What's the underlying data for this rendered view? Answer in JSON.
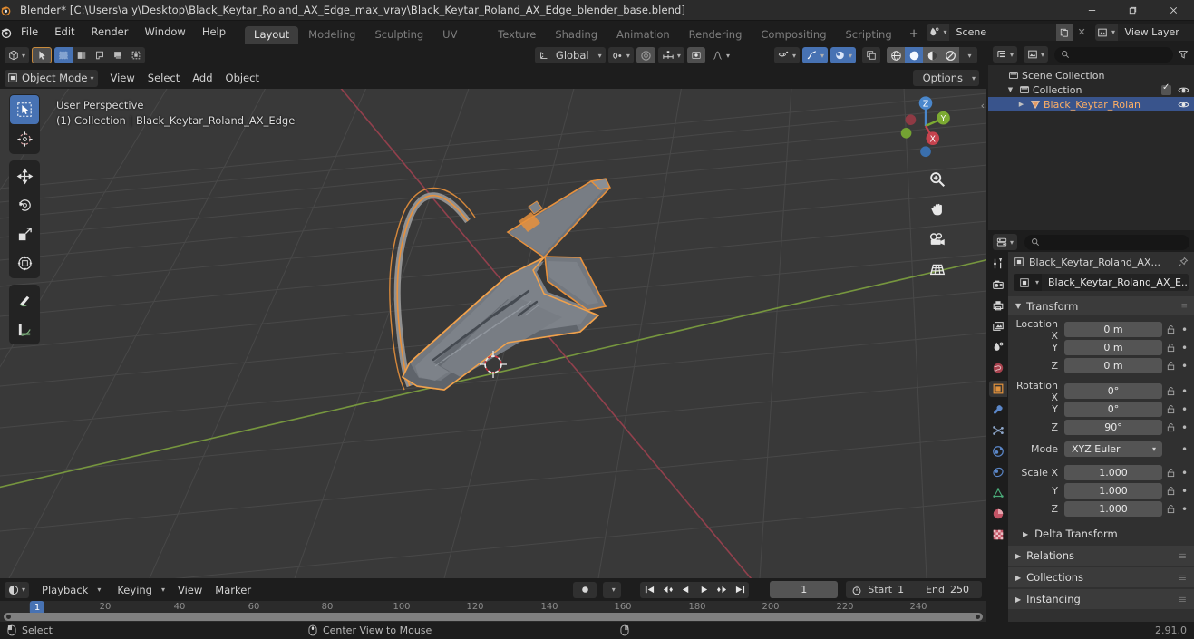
{
  "window": {
    "title": "Blender* [C:\\Users\\a y\\Desktop\\Black_Keytar_Roland_AX_Edge_max_vray\\Black_Keytar_Roland_AX_Edge_blender_base.blend]",
    "minimize": "—",
    "maximize": "❐",
    "close": "✕"
  },
  "topbar": {
    "menus": [
      "File",
      "Edit",
      "Render",
      "Window",
      "Help"
    ],
    "workspace_tabs": [
      {
        "label": "Layout",
        "active": true
      },
      {
        "label": "Modeling",
        "active": false
      },
      {
        "label": "Sculpting",
        "active": false
      },
      {
        "label": "UV Editing",
        "active": false
      },
      {
        "label": "Texture Paint",
        "active": false
      },
      {
        "label": "Shading",
        "active": false
      },
      {
        "label": "Animation",
        "active": false
      },
      {
        "label": "Rendering",
        "active": false
      },
      {
        "label": "Compositing",
        "active": false
      },
      {
        "label": "Scripting",
        "active": false
      }
    ],
    "add_workspace": "+",
    "scene_name": "Scene",
    "view_layer_name": "View Layer"
  },
  "viewport": {
    "header": {
      "editor_type": "editor-type-3dview",
      "transform_orientation": "Global",
      "options_label": "Options"
    },
    "subheader": {
      "mode": "Object Mode",
      "menus": [
        "View",
        "Select",
        "Add",
        "Object"
      ]
    },
    "overlay_text_line1": "User Perspective",
    "overlay_text_line2": "(1) Collection | Black_Keytar_Roland_AX_Edge",
    "gizmo_axes": [
      "X",
      "Y",
      "Z"
    ],
    "colors": {
      "background": "#393939",
      "grid_line": "#4b4b4b",
      "axis_x_red": "#97414e",
      "axis_y_green": "#7a9b3f",
      "selection_orange": "#e8913c",
      "accent_blue": "#4772b3"
    },
    "object_label": "Black_Keytar_Roland_AX_Edge"
  },
  "timeline": {
    "menus": [
      "Playback",
      "Keying",
      "View",
      "Marker"
    ],
    "current_frame": "1",
    "start_label": "Start",
    "start_value": "1",
    "end_label": "End",
    "end_value": "250",
    "ticks": [
      "20",
      "40",
      "60",
      "80",
      "100",
      "120",
      "140",
      "160",
      "180",
      "200",
      "220",
      "240"
    ],
    "playhead_label": "1"
  },
  "outliner": {
    "search_placeholder": "",
    "rows": [
      {
        "label": "Scene Collection",
        "depth": 0,
        "icon": "collection-icon",
        "selected": false,
        "disclosure": "",
        "checkbox": false,
        "eye": false
      },
      {
        "label": "Collection",
        "depth": 1,
        "icon": "collection-icon",
        "selected": false,
        "disclosure": "▼",
        "checkbox": true,
        "eye": true
      },
      {
        "label": "Black_Keytar_Rolan",
        "depth": 2,
        "icon": "mesh-object-icon",
        "selected": true,
        "disclosure": "▶",
        "checkbox": false,
        "eye": true
      }
    ]
  },
  "properties": {
    "search_placeholder": "",
    "breadcrumb_object": "Black_Keytar_Roland_AX...",
    "object_name_field": "Black_Keytar_Roland_AX_E...",
    "transform_panel": "Transform",
    "rows": [
      {
        "label": "Location X",
        "value": "0 m"
      },
      {
        "label": "Y",
        "value": "0 m"
      },
      {
        "label": "Z",
        "value": "0 m"
      },
      {
        "label": "Rotation X",
        "value": "0°"
      },
      {
        "label": "Y",
        "value": "0°"
      },
      {
        "label": "Z",
        "value": "90°"
      },
      {
        "label": "Scale X",
        "value": "1.000"
      },
      {
        "label": "Y",
        "value": "1.000"
      },
      {
        "label": "Z",
        "value": "1.000"
      }
    ],
    "mode_label": "Mode",
    "mode_value": "XYZ Euler",
    "delta_transform": "Delta Transform",
    "collapsed_panels": [
      "Relations",
      "Collections",
      "Instancing"
    ],
    "tabs": [
      {
        "name": "tool-tab",
        "active": false
      },
      {
        "name": "render-tab",
        "active": false
      },
      {
        "name": "output-tab",
        "active": false
      },
      {
        "name": "view-layer-tab",
        "active": false
      },
      {
        "name": "scene-tab",
        "active": false
      },
      {
        "name": "world-tab",
        "active": false
      },
      {
        "name": "object-tab",
        "active": true
      },
      {
        "name": "modifier-tab",
        "active": false
      },
      {
        "name": "particles-tab",
        "active": false
      },
      {
        "name": "physics-tab",
        "active": false
      },
      {
        "name": "constraints-tab",
        "active": false
      },
      {
        "name": "object-data-tab",
        "active": false
      },
      {
        "name": "material-tab",
        "active": false
      },
      {
        "name": "texture-tab",
        "active": false
      }
    ]
  },
  "statusbar": {
    "left_action": "Select",
    "middle_action": "Center View to Mouse",
    "version": "2.91.0"
  }
}
